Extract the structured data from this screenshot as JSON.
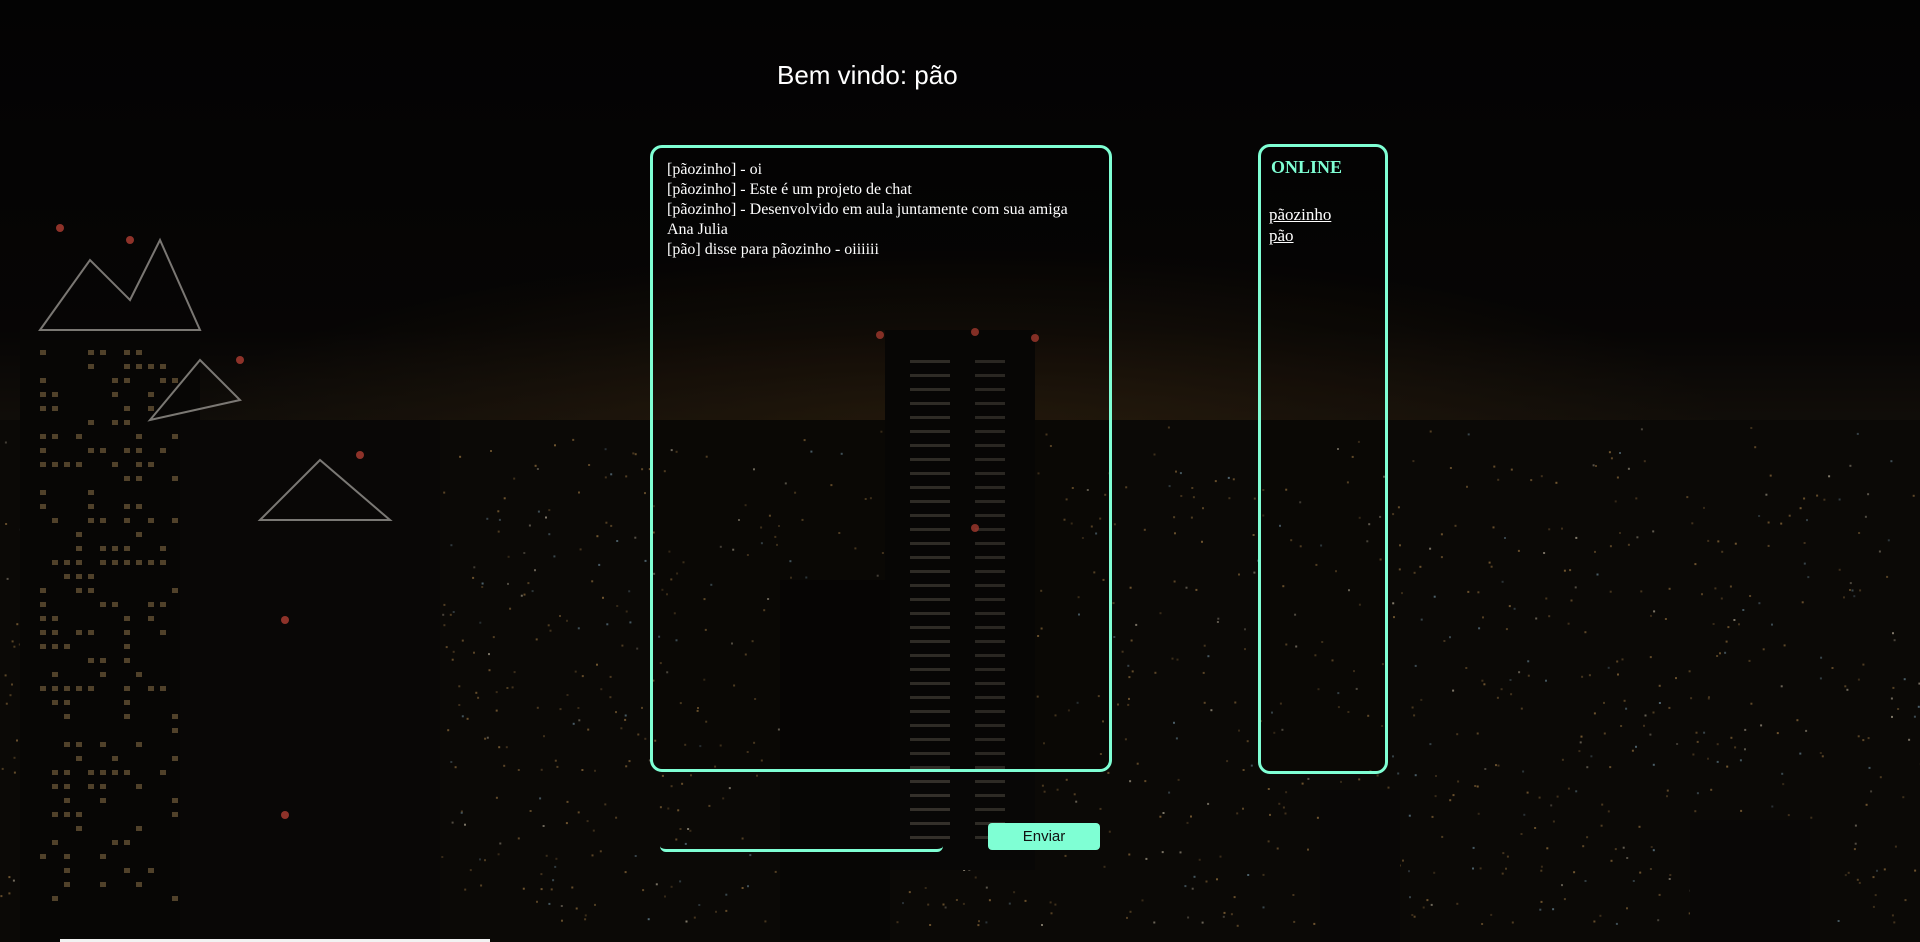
{
  "header": {
    "welcome_text": "Bem vindo: pão"
  },
  "chat": {
    "messages": [
      "[pãozinho] - oi",
      "[pãozinho] - Este é um projeto de chat",
      "[pãozinho] - Desenvolvido em aula juntamente com sua amiga Ana Julia",
      "[pão] disse para pãozinho - oiiiiii"
    ]
  },
  "online": {
    "title": "ONLINE",
    "users": [
      "pãozinho",
      "pão"
    ]
  },
  "composer": {
    "input_value": "",
    "input_placeholder": "",
    "send_label": "Enviar"
  },
  "theme": {
    "accent": "#7fffd4",
    "text": "#ffffff",
    "background": "#050405"
  }
}
